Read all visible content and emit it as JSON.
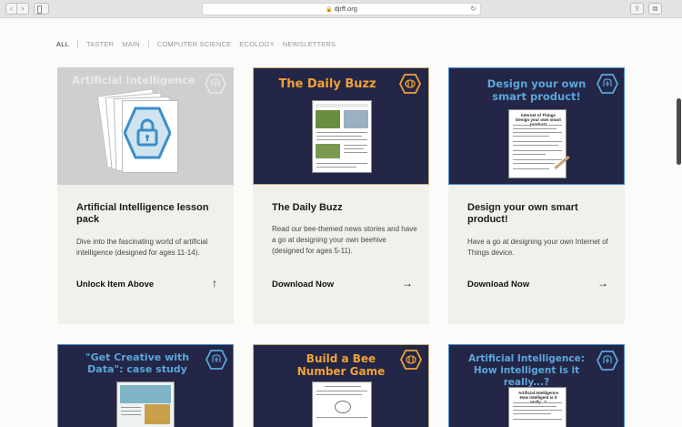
{
  "browser": {
    "url": "djrff.org",
    "back": "‹",
    "forward": "›",
    "reload": "↻",
    "share": "⇪",
    "tabs": "⧉"
  },
  "filters": [
    "ALL",
    "TASTER",
    "MAIN",
    "COMPUTER SCIENCE",
    "ECOLOGY",
    "NEWSLETTERS"
  ],
  "cards": [
    {
      "thumb_title": "Artificial Intelligence",
      "title": "Artificial Intelligence lesson pack",
      "desc": "Dive into the fascinating world of artificial intelligence (designed for ages 11-14).",
      "cta": "Unlock Item Above",
      "arrow": "↑"
    },
    {
      "thumb_title": "The Daily Buzz",
      "title": "The Daily Buzz",
      "desc": "Read our bee-themed news stories and have a go at designing your own beehive (designed for ages 5-11).",
      "cta": "Download Now",
      "arrow": "→"
    },
    {
      "thumb_title": "Design your own smart product!",
      "title": "Design your own smart product!",
      "desc": "Have a go at designing your own Internet of Things device.",
      "cta": "Download Now",
      "arrow": "→"
    },
    {
      "thumb_title": "\"Get Creative with Data\": case study"
    },
    {
      "thumb_title": "Build a Bee Number Game"
    },
    {
      "thumb_title": "Artificial Intelligence: How intelligent is it really...?"
    }
  ],
  "colors": {
    "navy": "#232646",
    "orange": "#f0a237",
    "blue": "#5ba6dc",
    "card_bg": "#f1f1ec"
  }
}
